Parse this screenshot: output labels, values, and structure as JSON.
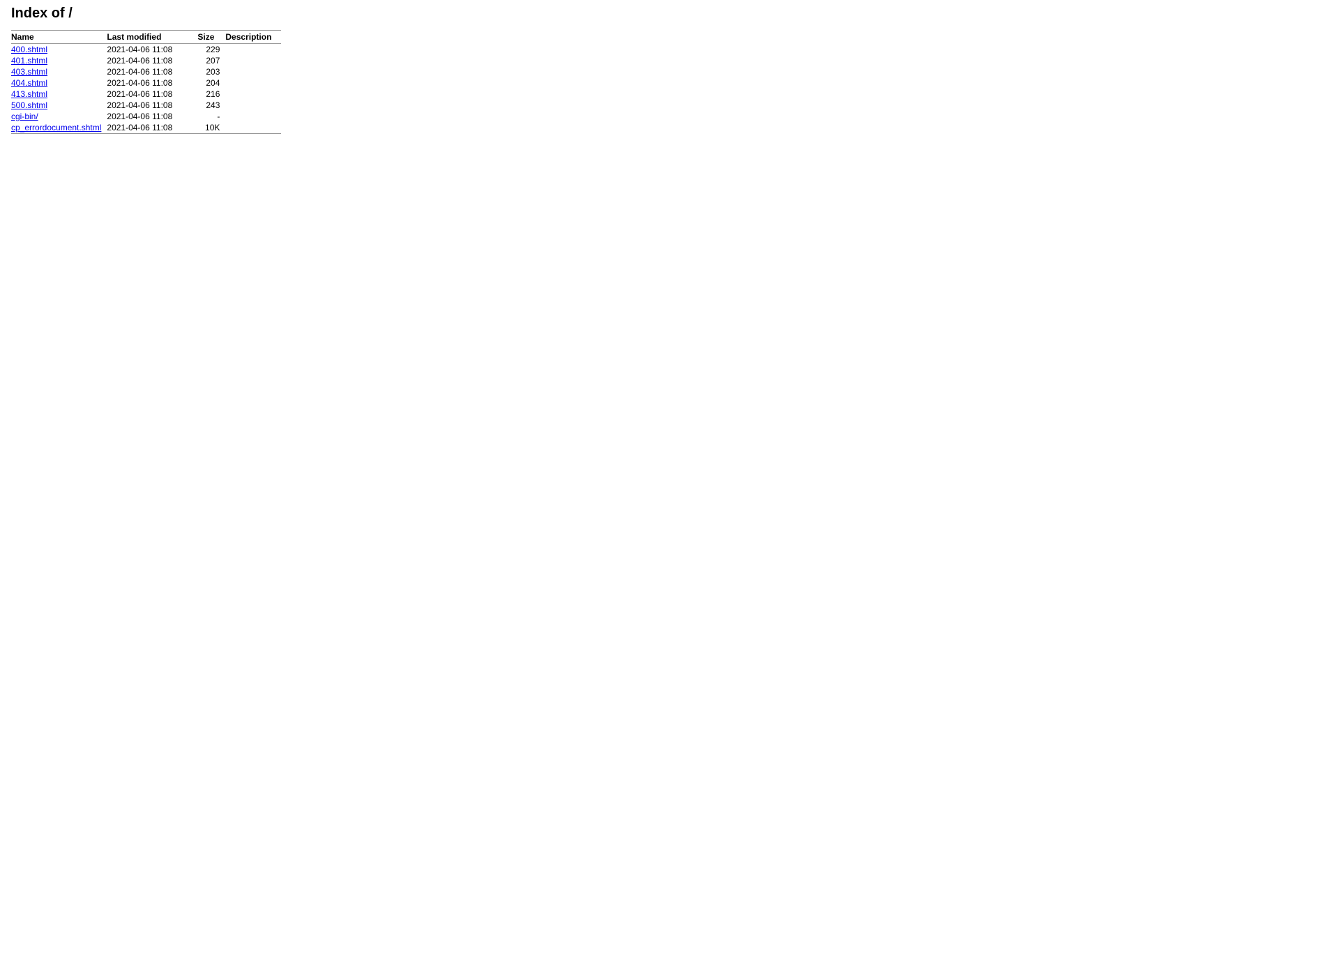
{
  "page": {
    "title": "Index of /"
  },
  "table": {
    "headers": {
      "name": "Name",
      "last_modified": "Last modified",
      "size": "Size",
      "description": "Description"
    },
    "rows": [
      {
        "name": "400.shtml",
        "href": "400.shtml",
        "date": "2021-04-06 11:08",
        "size": "229",
        "description": ""
      },
      {
        "name": "401.shtml",
        "href": "401.shtml",
        "date": "2021-04-06 11:08",
        "size": "207",
        "description": ""
      },
      {
        "name": "403.shtml",
        "href": "403.shtml",
        "date": "2021-04-06 11:08",
        "size": "203",
        "description": ""
      },
      {
        "name": "404.shtml",
        "href": "404.shtml",
        "date": "2021-04-06 11:08",
        "size": "204",
        "description": ""
      },
      {
        "name": "413.shtml",
        "href": "413.shtml",
        "date": "2021-04-06 11:08",
        "size": "216",
        "description": ""
      },
      {
        "name": "500.shtml",
        "href": "500.shtml",
        "date": "2021-04-06 11:08",
        "size": "243",
        "description": ""
      },
      {
        "name": "cgi-bin/",
        "href": "cgi-bin/",
        "date": "2021-04-06 11:08",
        "size": "-",
        "description": ""
      },
      {
        "name": "cp_errordocument.shtml",
        "href": "cp_errordocument.shtml",
        "date": "2021-04-06 11:08",
        "size": "10K",
        "description": ""
      }
    ]
  }
}
